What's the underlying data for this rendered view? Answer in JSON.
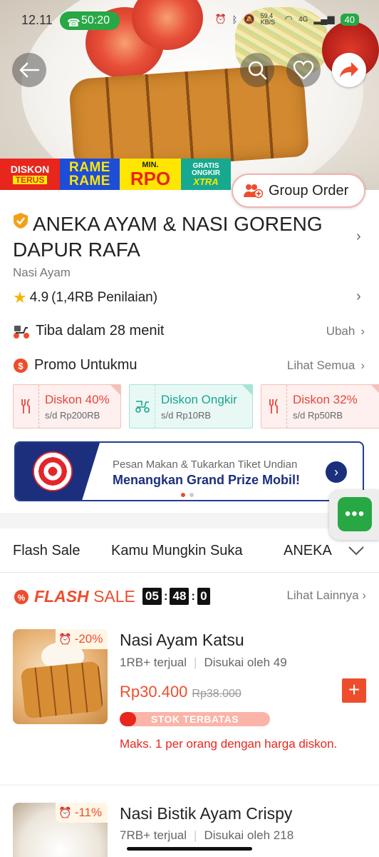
{
  "status_bar": {
    "time": "12.11",
    "call_timer": "50:20",
    "network_speed": "59.4 KB/S",
    "network_type": "4G",
    "battery": "40"
  },
  "hero": {
    "back_icon": "arrow-left-icon",
    "search_icon": "search-icon",
    "favorite_icon": "heart-icon",
    "share_icon": "share-arrow-icon",
    "promo_badges": {
      "diskon_terus": [
        "DISKON",
        "TERUS"
      ],
      "rame_rame": [
        "RAME",
        "RAME"
      ],
      "min_rpo": [
        "MIN.",
        "RPO"
      ],
      "gratis_ongkir": [
        "GRATIS",
        "ONGKIR",
        "XTRA"
      ]
    },
    "group_order_label": "Group Order"
  },
  "shop": {
    "name": "ANEKA AYAM & NASI GORENG DAPUR RAFA",
    "category": "Nasi Ayam",
    "rating": "4.9",
    "reviews": "(1,4RB Penilaian)",
    "delivery_label": "Tiba dalam 28 menit",
    "delivery_action": "Ubah",
    "promo_label": "Promo Untukmu",
    "promo_action": "Lihat Semua"
  },
  "vouchers": [
    {
      "title": "Diskon 40%",
      "subtitle": "s/d Rp200RB",
      "icon": "fork-knife-icon"
    },
    {
      "title": "Diskon Ongkir",
      "subtitle": "s/d Rp10RB",
      "icon": "delivery-scooter-icon"
    },
    {
      "title": "Diskon 32%",
      "subtitle": "s/d Rp50RB",
      "icon": "fork-knife-icon"
    }
  ],
  "banner": {
    "line1": "Pesan Makan & Tukarkan Tiket Undian",
    "line2": "Menangkan Grand Prize Mobil!"
  },
  "tabs": [
    "Flash Sale",
    "Kamu Mungkin Suka",
    "ANEKA"
  ],
  "flash_sale": {
    "logo_flash": "FLASH",
    "logo_sale": "SALE",
    "timer": [
      "05",
      "48",
      "0"
    ],
    "more_label": "Lihat Lainnya"
  },
  "products": [
    {
      "name": "Nasi Ayam Katsu",
      "discount": "-20%",
      "sold": "1RB+ terjual",
      "likes": "Disukai oleh 49",
      "price": "Rp30.400",
      "old_price": "Rp38.000",
      "stock_label": "STOK TERBATAS",
      "stock_level": 0.11,
      "limit_note": "Maks. 1 per orang dengan harga diskon."
    },
    {
      "name": "Nasi Bistik Ayam Crispy",
      "discount": "-11%",
      "sold": "7RB+ terjual",
      "likes": "Disukai oleh 218"
    }
  ],
  "colors": {
    "accent": "#ee4d2d",
    "green": "#27a845",
    "navy": "#1b2f7d"
  }
}
